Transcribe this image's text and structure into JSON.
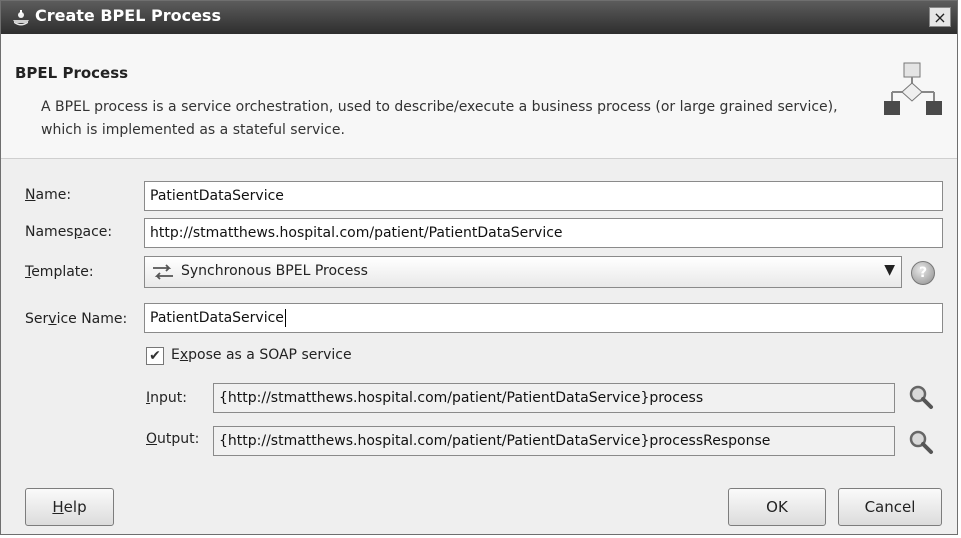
{
  "window": {
    "title": "Create BPEL Process",
    "close_symbol": "×"
  },
  "header": {
    "title": "BPEL Process",
    "description": "A BPEL process is a service orchestration, used to describe/execute a business process (or large grained service), which is implemented as a stateful service."
  },
  "form": {
    "name": {
      "label_u": "N",
      "label_rest": "ame:",
      "value": "PatientDataService"
    },
    "namespace": {
      "label_pre": "Names",
      "label_u": "p",
      "label_rest": "ace:",
      "value": "http://stmatthews.hospital.com/patient/PatientDataService"
    },
    "template": {
      "label_u": "T",
      "label_rest": "emplate:",
      "value": "Synchronous BPEL Process",
      "arrow": "▼",
      "help": "?"
    },
    "service_name": {
      "label_pre": "Ser",
      "label_u": "v",
      "label_rest": "ice Name:",
      "value": "PatientDataService"
    },
    "expose_soap": {
      "checked_symbol": "✔",
      "label_pre": "E",
      "label_u": "x",
      "label_rest": "pose as a SOAP service"
    },
    "input": {
      "label_u": "I",
      "label_rest": "nput:",
      "value": "{http://stmatthews.hospital.com/patient/PatientDataService}process"
    },
    "output": {
      "label_u": "O",
      "label_rest": "utput:",
      "value": "{http://stmatthews.hospital.com/patient/PatientDataService}processResponse"
    }
  },
  "buttons": {
    "help_u": "H",
    "help_rest": "elp",
    "ok": "OK",
    "cancel": "Cancel"
  }
}
